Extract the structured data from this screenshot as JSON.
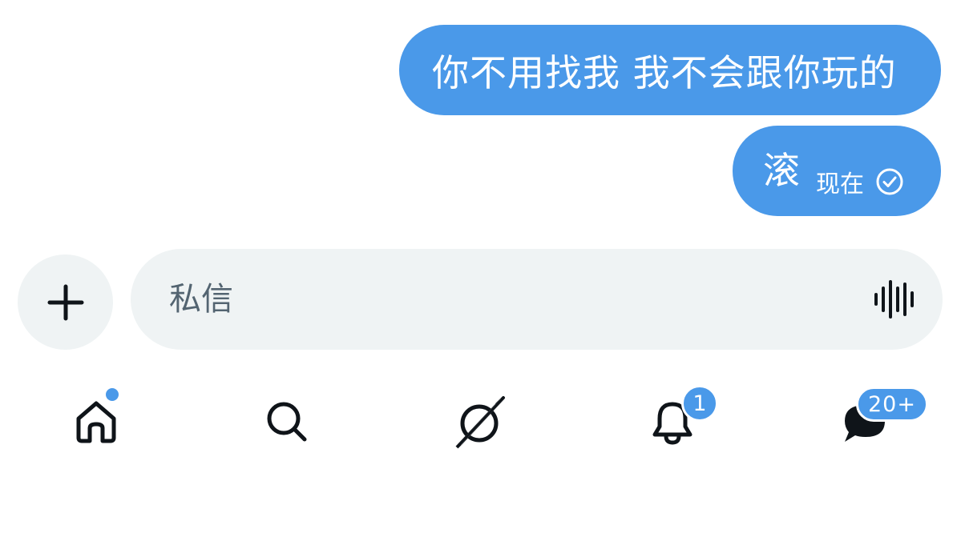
{
  "messages": [
    {
      "text": "你不用找我 我不会跟你玩的"
    },
    {
      "text": "滚",
      "time": "现在",
      "status_icon": "sent-check-icon"
    }
  ],
  "composer": {
    "placeholder": "私信",
    "add_icon": "plus-icon",
    "voice_icon": "voice-waveform-icon"
  },
  "nav": {
    "items": [
      {
        "name": "home",
        "icon": "home-icon",
        "has_dot": true
      },
      {
        "name": "search",
        "icon": "search-icon"
      },
      {
        "name": "grok",
        "icon": "grok-icon"
      },
      {
        "name": "notifications",
        "icon": "bell-icon",
        "badge": "1"
      },
      {
        "name": "messages",
        "icon": "chat-bubble-icon",
        "badge": "20+"
      }
    ]
  },
  "colors": {
    "accent": "#4a99e9",
    "composer_bg": "#eff3f4",
    "placeholder": "#536471"
  }
}
